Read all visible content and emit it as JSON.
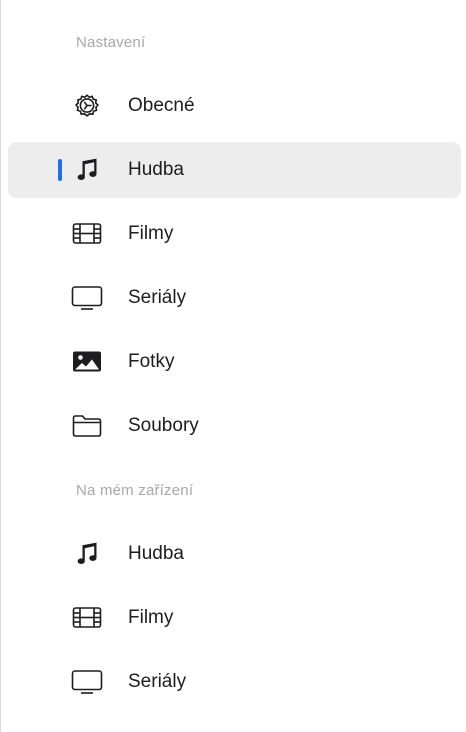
{
  "sections": [
    {
      "header": "Nastavení",
      "items": [
        {
          "label": "Obecné",
          "icon": "gear-icon",
          "selected": false
        },
        {
          "label": "Hudba",
          "icon": "music-note-icon",
          "selected": true
        },
        {
          "label": "Filmy",
          "icon": "film-strip-icon",
          "selected": false
        },
        {
          "label": "Seriály",
          "icon": "tv-monitor-icon",
          "selected": false
        },
        {
          "label": "Fotky",
          "icon": "photo-icon",
          "selected": false
        },
        {
          "label": "Soubory",
          "icon": "folder-icon",
          "selected": false
        }
      ]
    },
    {
      "header": "Na mém zařízení",
      "items": [
        {
          "label": "Hudba",
          "icon": "music-note-icon",
          "selected": false
        },
        {
          "label": "Filmy",
          "icon": "film-strip-icon",
          "selected": false
        },
        {
          "label": "Seriály",
          "icon": "tv-monitor-icon",
          "selected": false
        }
      ]
    }
  ],
  "colors": {
    "accent": "#1f6feb",
    "selected_background": "#ededed",
    "header_text": "#a8a8a8",
    "item_text": "#1d1d1f"
  }
}
